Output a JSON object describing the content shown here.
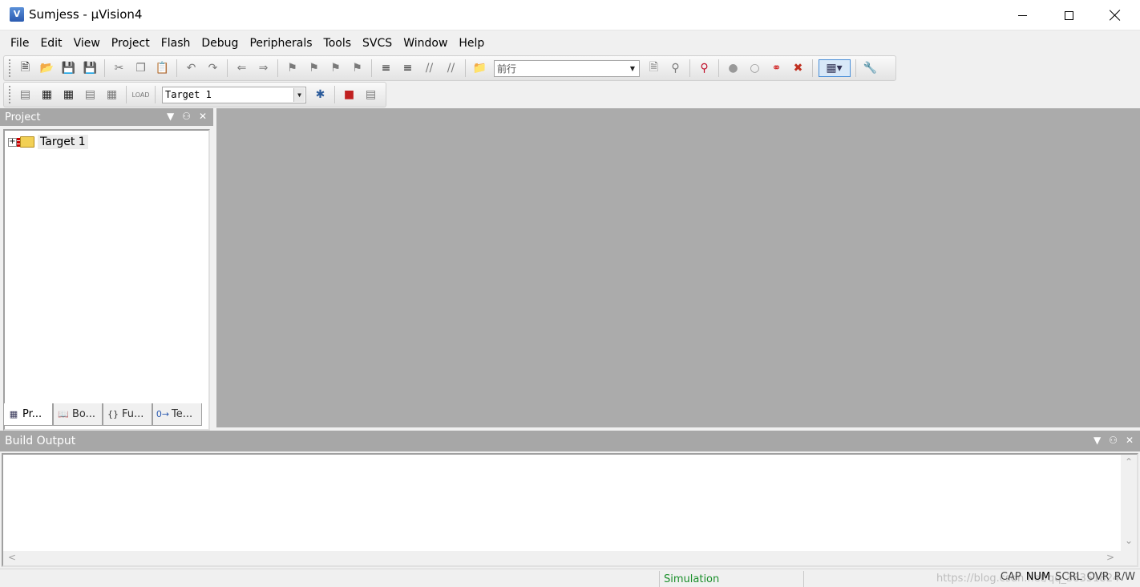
{
  "window": {
    "title": "Sumjess  - μVision4",
    "app_icon": "V"
  },
  "menu": [
    {
      "label": "File",
      "key": "file"
    },
    {
      "label": "Edit",
      "key": "edit"
    },
    {
      "label": "View",
      "key": "view"
    },
    {
      "label": "Project",
      "key": "project"
    },
    {
      "label": "Flash",
      "key": "flash"
    },
    {
      "label": "Debug",
      "key": "debug"
    },
    {
      "label": "Peripherals",
      "key": "peripherals"
    },
    {
      "label": "Tools",
      "key": "tools"
    },
    {
      "label": "SVCS",
      "key": "svcs"
    },
    {
      "label": "Window",
      "key": "window"
    },
    {
      "label": "Help",
      "key": "help"
    }
  ],
  "toolbar": {
    "find_value": "前行",
    "target_value": "Target 1"
  },
  "project_panel": {
    "title": "Project",
    "tree_root": "Target 1",
    "tabs": [
      "Pr...",
      "Bo...",
      "Fu...",
      "Te..."
    ]
  },
  "build_panel": {
    "title": "Build Output"
  },
  "status": {
    "mode": "Simulation",
    "watermark": "https://blog.csdn.net/qq_38351824",
    "keys": [
      "CAP",
      "NUM",
      "SCRL",
      "OVR",
      "R/W"
    ]
  },
  "colors": {
    "workspace": "#ababab",
    "panel_header": "#a7a7a7",
    "status_mode": "#1a8f2a"
  }
}
